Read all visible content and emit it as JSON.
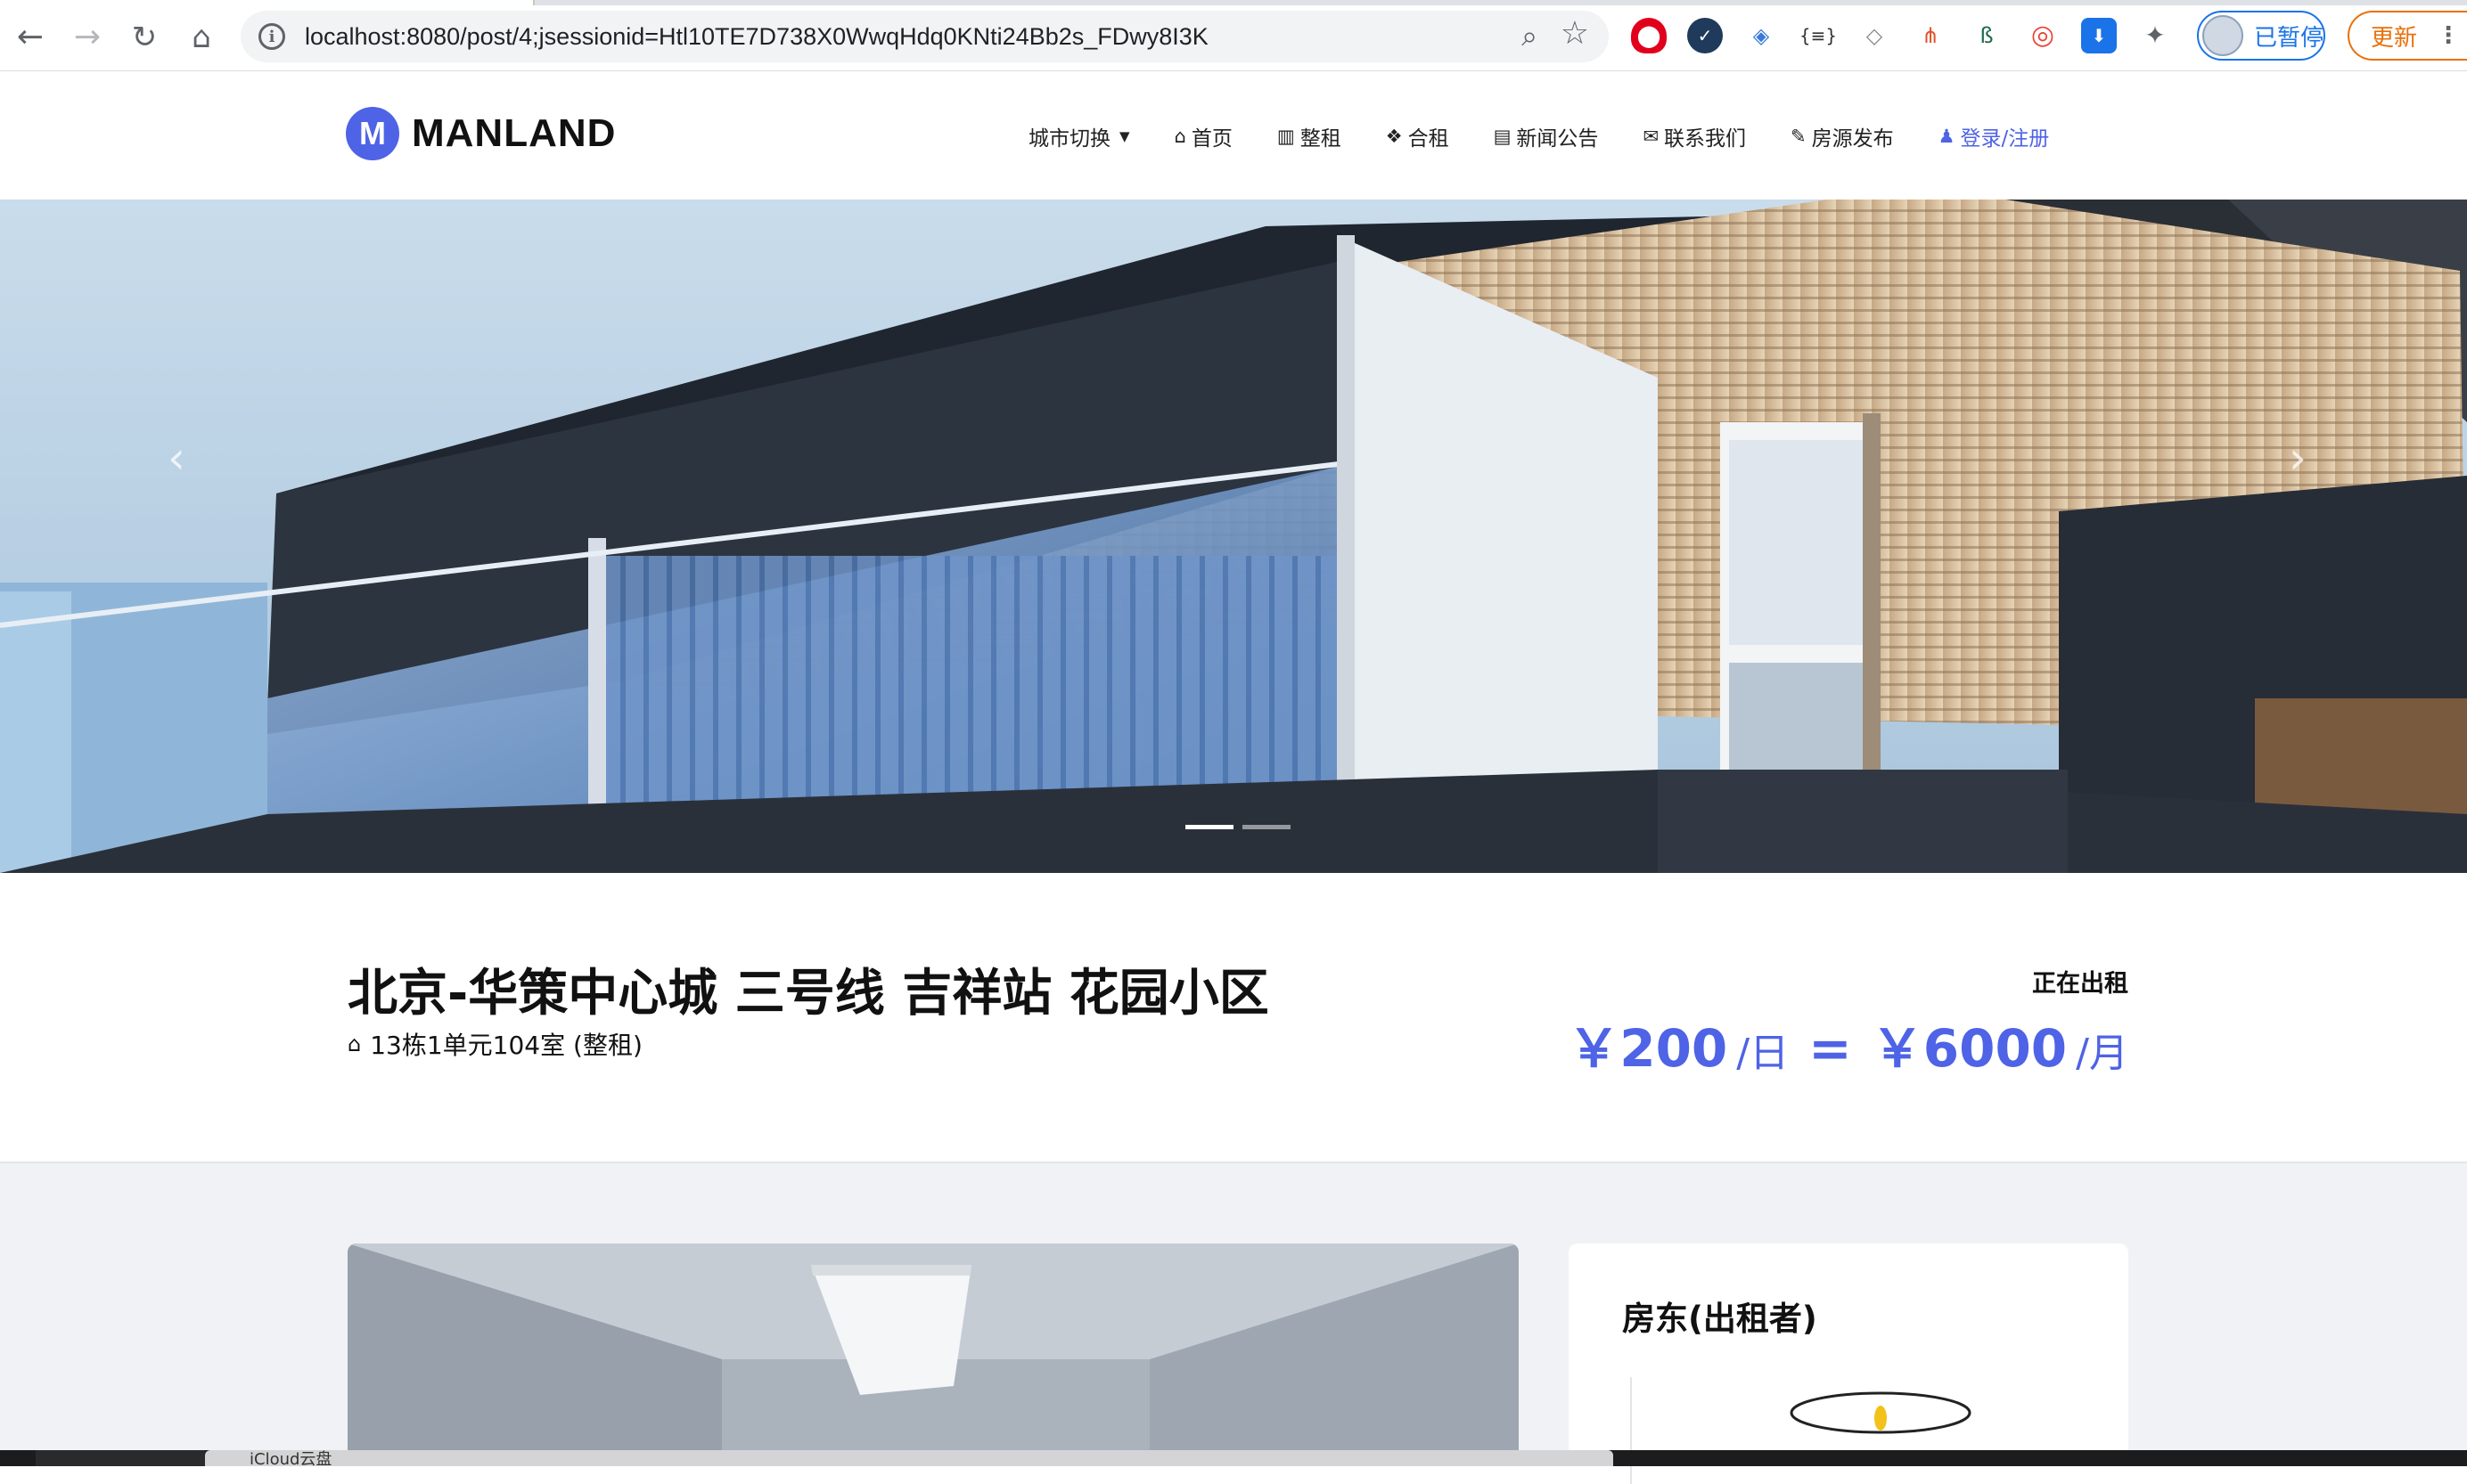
{
  "browser": {
    "url": "localhost:8080/post/4;jsessionid=Htl10TE7D738X0WwqHdq0KNti24Bb2s_FDwy8I3K",
    "profile_label": "已暂停",
    "update_label": "更新",
    "icons": [
      "back-icon",
      "forward-icon",
      "reload-icon",
      "home-icon",
      "site-info-icon",
      "zoom-icon",
      "bookmark-star-icon",
      "extensions-icon",
      "menu-dots-icon"
    ]
  },
  "site": {
    "brand": "MANLAND",
    "logo_letter": "M",
    "accent_color": "#4e63e6",
    "nav": [
      {
        "label": "城市切换",
        "icon": "dropdown-caret-icon"
      },
      {
        "label": "首页",
        "icon": "home-icon"
      },
      {
        "label": "整租",
        "icon": "building-icon"
      },
      {
        "label": "合租",
        "icon": "cubes-icon"
      },
      {
        "label": "新闻公告",
        "icon": "newspaper-icon"
      },
      {
        "label": "联系我们",
        "icon": "envelope-icon"
      },
      {
        "label": "房源发布",
        "icon": "pencil-icon"
      },
      {
        "label": "登录/注册",
        "icon": "user-icon"
      }
    ]
  },
  "hero": {
    "slides": 2,
    "active_slide": 1
  },
  "listing": {
    "title": "北京-华策中心城 三号线 吉祥站 花园小区",
    "address": "13栋1单元104室 (整租)",
    "status": "正在出租",
    "price_day": "￥200",
    "unit_day": "/日",
    "equals": "=",
    "price_month": "￥6000",
    "unit_month": "/月"
  },
  "landlord": {
    "heading": "房东(出租者)"
  },
  "taskbar": {
    "item_label": "iCloud云盘"
  }
}
